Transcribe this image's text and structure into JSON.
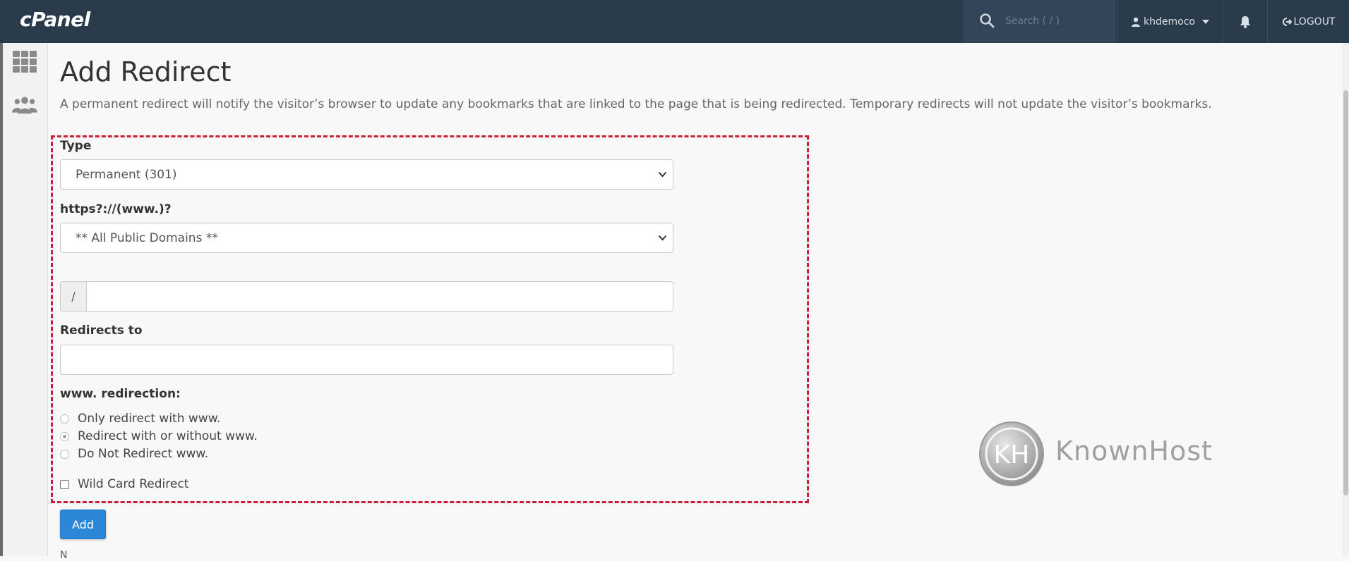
{
  "header": {
    "logo_text": "cPanel",
    "search_placeholder": "Search ( / )",
    "username": "khdemoco",
    "logout_label": "LOGOUT"
  },
  "sidebar": {
    "items": [
      {
        "icon": "grid-icon"
      },
      {
        "icon": "users-icon"
      }
    ]
  },
  "page": {
    "title": "Add Redirect",
    "description": "A permanent redirect will notify the visitor’s browser to update any bookmarks that are linked to the page that is being redirected. Temporary redirects will not update the visitor’s bookmarks."
  },
  "form": {
    "type_label": "Type",
    "type_value": "Permanent (301)",
    "domain_label": "https?://(www.)?",
    "domain_value": "** All Public Domains **",
    "path_prefix": "/",
    "path_value": "",
    "redirects_to_label": "Redirects to",
    "redirects_to_value": "",
    "www_label": "www. redirection:",
    "www_options": [
      {
        "label": "Only redirect with www.",
        "checked": false
      },
      {
        "label": "Redirect with or without www.",
        "checked": true
      },
      {
        "label": "Do Not Redirect www.",
        "checked": false
      }
    ],
    "wildcard_label": "Wild Card Redirect",
    "wildcard_checked": false,
    "add_button_label": "Add",
    "cut_text": "N"
  },
  "watermark": {
    "brand": "KnownHost",
    "monogram": "KH"
  },
  "colors": {
    "topbar": "#293a4a",
    "accent_button": "#2b88d8",
    "highlight_border": "#c91e36"
  }
}
